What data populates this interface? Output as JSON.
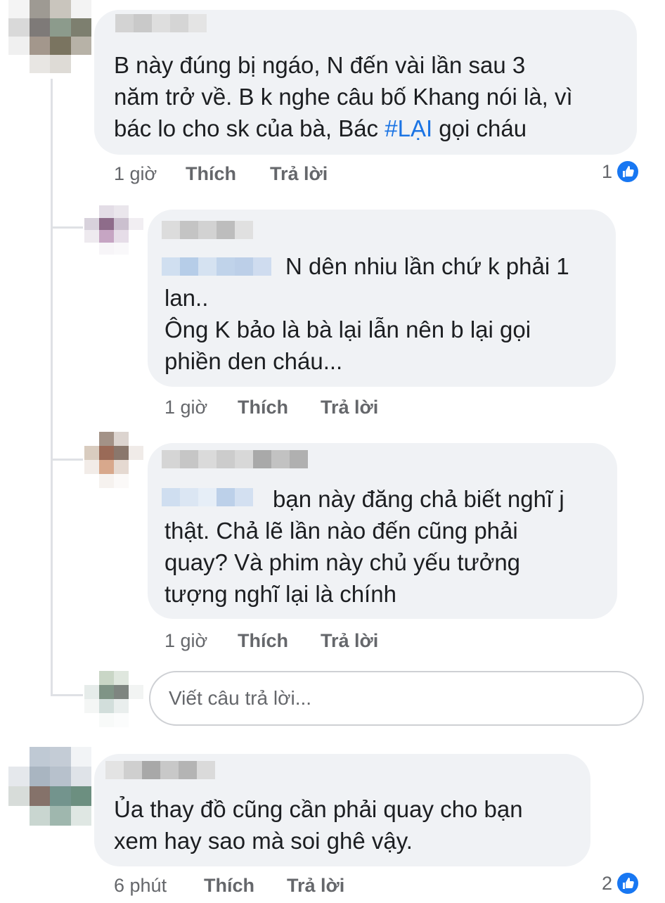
{
  "comments": [
    {
      "text": "B  này đúng bị ngáo,  N đến vài lần sau 3\nnăm trở về. B k nghe câu bố Khang nói là, vì\nbác lo cho sk của bà, Bác ",
      "hashtag": "#LẠI",
      "text_after": " gọi cháu",
      "time": "1 giờ",
      "like_label": "Thích",
      "reply_label": "Trả lời",
      "reaction_count": "1"
    },
    {
      "text_first": "N dên nhiu lần chứ k phải 1",
      "text_rest": "lan..\nÔng K bảo là bà lại lẫn nên b lại gọi\nphiền den cháu...",
      "time": "1 giờ",
      "like_label": "Thích",
      "reply_label": "Trả lời"
    },
    {
      "text_first": "bạn này đăng chả biết nghĩ j",
      "text_rest": "thật. Chả lẽ lần nào đến cũng phải\nquay? Và phim này chủ yếu tưởng\ntượng nghĩ lại là chính",
      "time": "1 giờ",
      "like_label": "Thích",
      "reply_label": "Trả lời"
    },
    {
      "text": "Ủa thay đồ cũng cần phải quay cho bạn\nxem hay sao mà soi ghê vậy.",
      "time": "6 phút",
      "like_label": "Thích",
      "reply_label": "Trả lời",
      "reaction_count": "2"
    }
  ],
  "reply_box": {
    "placeholder": "Viết câu trả lời..."
  },
  "colors": {
    "bubble": "#f0f2f5",
    "hashtag": "#1b74e4",
    "meta": "#65676b",
    "like_blue": "#1877f2"
  }
}
